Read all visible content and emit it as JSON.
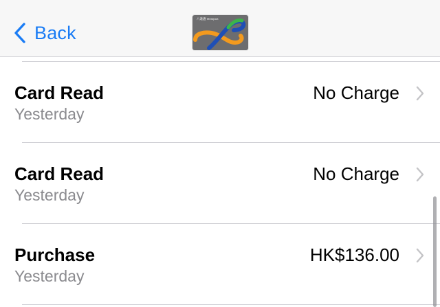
{
  "navbar": {
    "back_label": "Back",
    "card": {
      "brand_text": "八達通 Octopus",
      "background_color": "#6d6d6f",
      "accent_colors": [
        "#f39a1e",
        "#1f4fb5",
        "#3cb54a"
      ]
    }
  },
  "colors": {
    "accent": "#1a7cf5",
    "secondary_text": "#8a8a8e",
    "divider": "#d1d1d6"
  },
  "transactions": [
    {
      "title": "Card Read",
      "date": "Yesterday",
      "amount": "No Charge"
    },
    {
      "title": "Card Read",
      "date": "Yesterday",
      "amount": "No Charge"
    },
    {
      "title": "Purchase",
      "date": "Yesterday",
      "amount": "HK$136.00"
    }
  ]
}
